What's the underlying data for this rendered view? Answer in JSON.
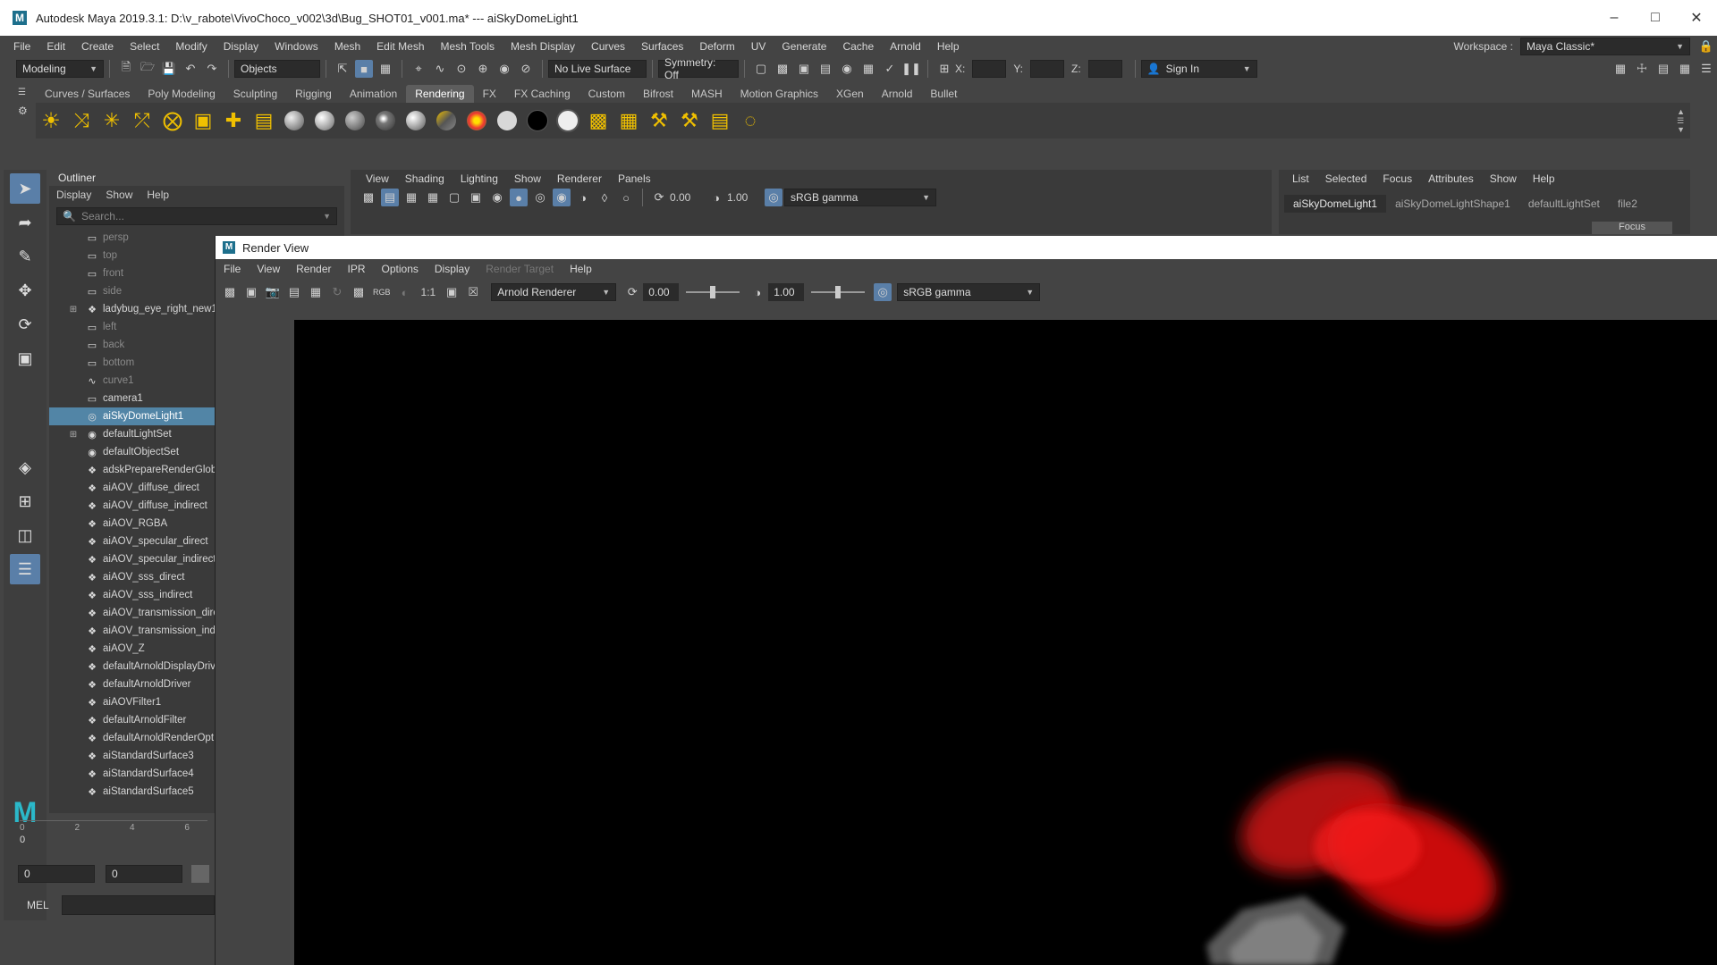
{
  "window": {
    "title": "Autodesk Maya 2019.3.1: D:\\v_rabote\\VivoChoco_v002\\3d\\Bug_SHOT01_v001.ma*  ---  aiSkyDomeLight1"
  },
  "menubar": {
    "items": [
      "File",
      "Edit",
      "Create",
      "Select",
      "Modify",
      "Display",
      "Windows",
      "Mesh",
      "Edit Mesh",
      "Mesh Tools",
      "Mesh Display",
      "Curves",
      "Surfaces",
      "Deform",
      "UV",
      "Generate",
      "Cache",
      "Arnold",
      "Help"
    ],
    "workspace_label": "Workspace :",
    "workspace_value": "Maya Classic*"
  },
  "statusline": {
    "mode": "Modeling",
    "select_mode": "Objects",
    "live_surface": "No Live Surface",
    "symmetry": "Symmetry: Off",
    "x_label": "X:",
    "y_label": "Y:",
    "z_label": "Z:",
    "sign_in": "Sign In"
  },
  "shelf": {
    "tabs": [
      "Curves / Surfaces",
      "Poly Modeling",
      "Sculpting",
      "Rigging",
      "Animation",
      "Rendering",
      "FX",
      "FX Caching",
      "Custom",
      "Bifrost",
      "MASH",
      "Motion Graphics",
      "XGen",
      "Arnold",
      "Bullet"
    ],
    "active_tab": "Rendering"
  },
  "outliner": {
    "title": "Outliner",
    "menus": [
      "Display",
      "Show",
      "Help"
    ],
    "search_placeholder": "Search...",
    "items": [
      {
        "label": "persp",
        "dim": true,
        "icon": "camera-icon",
        "expand": false
      },
      {
        "label": "top",
        "dim": true,
        "icon": "camera-icon",
        "expand": false
      },
      {
        "label": "front",
        "dim": true,
        "icon": "camera-icon",
        "expand": false
      },
      {
        "label": "side",
        "dim": true,
        "icon": "camera-icon",
        "expand": false
      },
      {
        "label": "ladybug_eye_right_new1",
        "dim": false,
        "icon": "transform-icon",
        "expand": true
      },
      {
        "label": "left",
        "dim": true,
        "icon": "camera-icon",
        "expand": false
      },
      {
        "label": "back",
        "dim": true,
        "icon": "camera-icon",
        "expand": false
      },
      {
        "label": "bottom",
        "dim": true,
        "icon": "camera-icon",
        "expand": false
      },
      {
        "label": "curve1",
        "dim": true,
        "icon": "curve-icon",
        "expand": false
      },
      {
        "label": "camera1",
        "dim": false,
        "icon": "camera-icon",
        "expand": false
      },
      {
        "label": "aiSkyDomeLight1",
        "dim": false,
        "icon": "skydome-icon",
        "expand": false,
        "selected": true
      },
      {
        "label": "defaultLightSet",
        "dim": false,
        "icon": "set-icon",
        "expand": true
      },
      {
        "label": "defaultObjectSet",
        "dim": false,
        "icon": "set-icon",
        "expand": false
      },
      {
        "label": "adskPrepareRenderGloba",
        "dim": false,
        "icon": "node-icon",
        "expand": false
      },
      {
        "label": "aiAOV_diffuse_direct",
        "dim": false,
        "icon": "node-icon",
        "expand": false
      },
      {
        "label": "aiAOV_diffuse_indirect",
        "dim": false,
        "icon": "node-icon",
        "expand": false
      },
      {
        "label": "aiAOV_RGBA",
        "dim": false,
        "icon": "node-icon",
        "expand": false
      },
      {
        "label": "aiAOV_specular_direct",
        "dim": false,
        "icon": "node-icon",
        "expand": false
      },
      {
        "label": "aiAOV_specular_indirect",
        "dim": false,
        "icon": "node-icon",
        "expand": false
      },
      {
        "label": "aiAOV_sss_direct",
        "dim": false,
        "icon": "node-icon",
        "expand": false
      },
      {
        "label": "aiAOV_sss_indirect",
        "dim": false,
        "icon": "node-icon",
        "expand": false
      },
      {
        "label": "aiAOV_transmission_dire",
        "dim": false,
        "icon": "node-icon",
        "expand": false
      },
      {
        "label": "aiAOV_transmission_indi",
        "dim": false,
        "icon": "node-icon",
        "expand": false
      },
      {
        "label": "aiAOV_Z",
        "dim": false,
        "icon": "node-icon",
        "expand": false
      },
      {
        "label": "defaultArnoldDisplayDriv",
        "dim": false,
        "icon": "node-icon",
        "expand": false
      },
      {
        "label": "defaultArnoldDriver",
        "dim": false,
        "icon": "node-icon",
        "expand": false
      },
      {
        "label": "aiAOVFilter1",
        "dim": false,
        "icon": "node-icon",
        "expand": false
      },
      {
        "label": "defaultArnoldFilter",
        "dim": false,
        "icon": "node-icon",
        "expand": false
      },
      {
        "label": "defaultArnoldRenderOpt",
        "dim": false,
        "icon": "node-icon",
        "expand": false
      },
      {
        "label": "aiStandardSurface3",
        "dim": false,
        "icon": "node-icon",
        "expand": false
      },
      {
        "label": "aiStandardSurface4",
        "dim": false,
        "icon": "node-icon",
        "expand": false
      },
      {
        "label": "aiStandardSurface5",
        "dim": false,
        "icon": "node-icon",
        "expand": false
      }
    ]
  },
  "timeline": {
    "ticks": [
      "0",
      "2",
      "4",
      "6"
    ],
    "current": "0",
    "range_start": "0",
    "range_end": "0"
  },
  "commandline": {
    "label": "MEL"
  },
  "viewport_panel": {
    "menus": [
      "View",
      "Shading",
      "Lighting",
      "Show",
      "Renderer",
      "Panels"
    ],
    "exposure": "0.00",
    "gamma": "1.00",
    "colorspace": "sRGB gamma"
  },
  "attribute_editor": {
    "menus": [
      "List",
      "Selected",
      "Focus",
      "Attributes",
      "Show",
      "Help"
    ],
    "tabs": [
      "aiSkyDomeLight1",
      "aiSkyDomeLightShape1",
      "defaultLightSet",
      "file2"
    ],
    "active_tab": "aiSkyDomeLight1",
    "focus_label": "Focus"
  },
  "render_view": {
    "title": "Render View",
    "menus": [
      {
        "label": "File",
        "disabled": false
      },
      {
        "label": "View",
        "disabled": false
      },
      {
        "label": "Render",
        "disabled": false
      },
      {
        "label": "IPR",
        "disabled": false
      },
      {
        "label": "Options",
        "disabled": false
      },
      {
        "label": "Display",
        "disabled": false
      },
      {
        "label": "Render Target",
        "disabled": true
      },
      {
        "label": "Help",
        "disabled": false
      }
    ],
    "rgb_label": "RGB",
    "ratio_label": "1:1",
    "renderer": "Arnold Renderer",
    "exposure": "0.00",
    "exposure_level": 0.5,
    "gamma": "1.00",
    "gamma_level": 0.5,
    "colorspace": "sRGB gamma"
  }
}
